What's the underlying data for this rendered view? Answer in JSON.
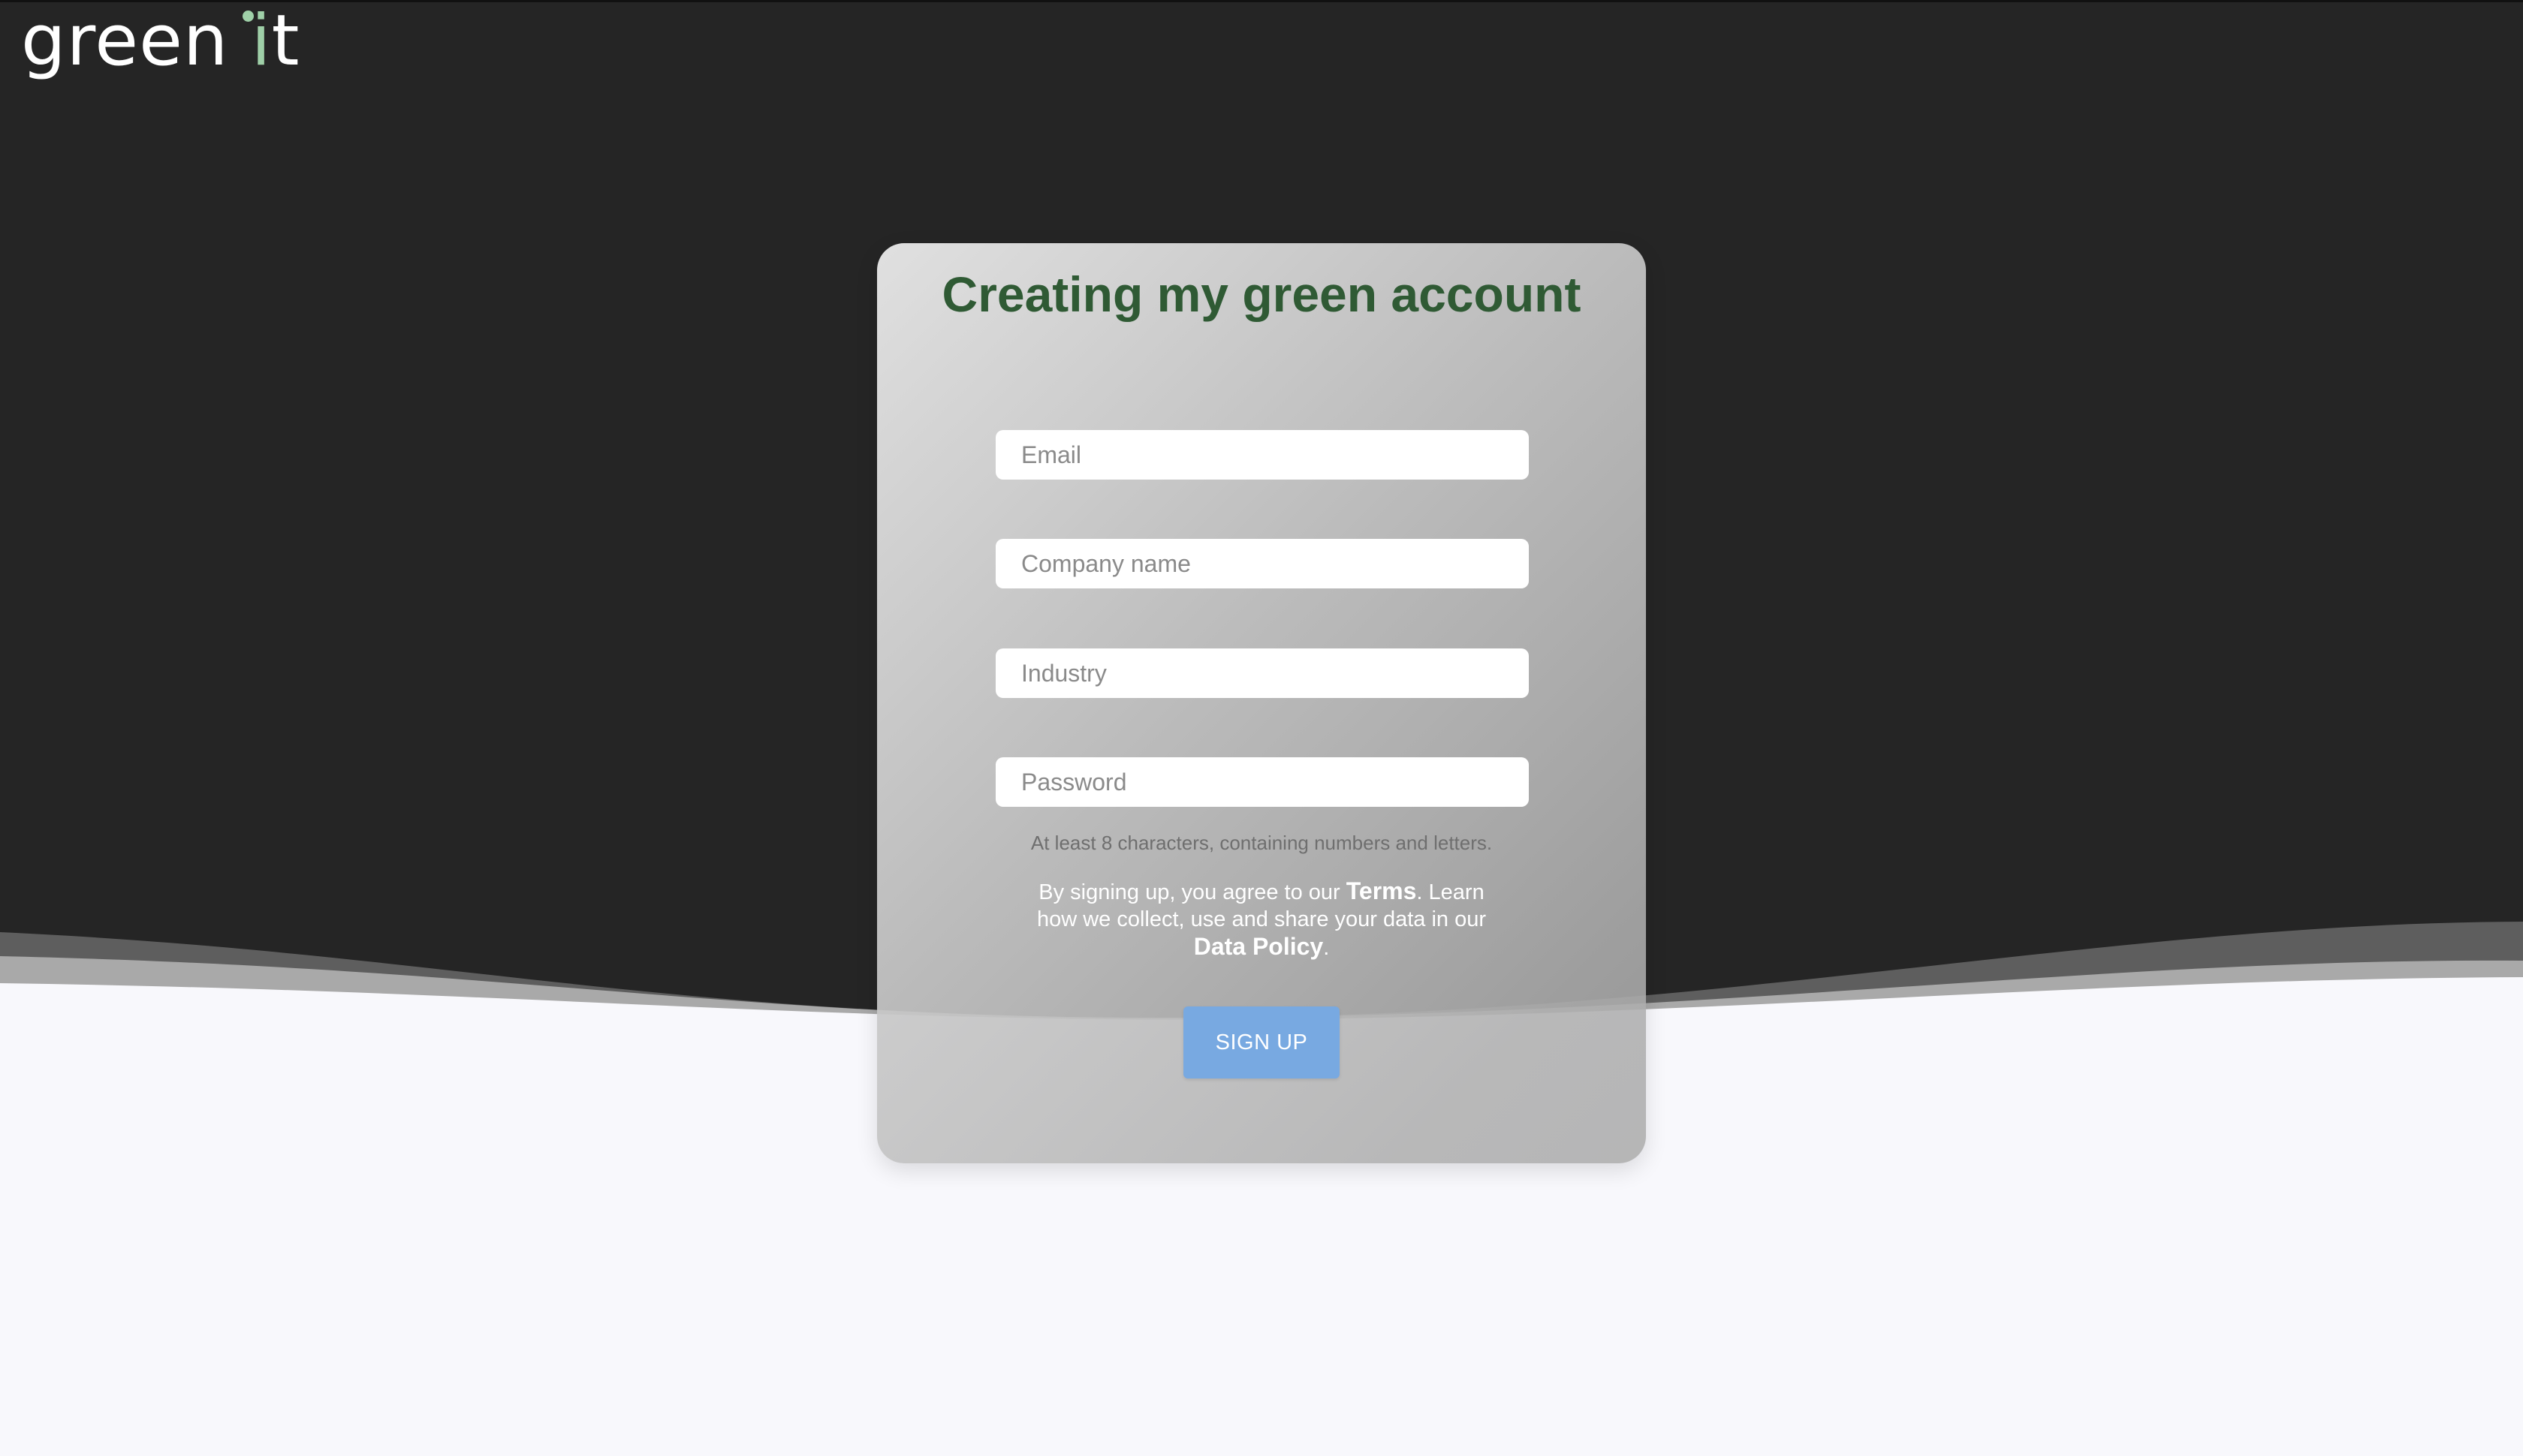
{
  "logo": {
    "word1": "green",
    "word2_i": "i",
    "word2_t": "t"
  },
  "form": {
    "title": "Creating my green account",
    "email_placeholder": "Email",
    "company_placeholder": "Company name",
    "industry_placeholder": "Industry",
    "password_placeholder": "Password",
    "password_hint": "At least 8 characters, containing numbers and letters.",
    "legal": {
      "part1": "By signing up, you agree to our ",
      "terms_link": "Terms",
      "part2": ". Learn how we collect, use and share your data in our ",
      "policy_link": "Data Policy",
      "part3": "."
    },
    "signup_label": "SIGN UP"
  },
  "colors": {
    "title": "#2f5a34",
    "logo_accent": "#9fd0a8",
    "signup_button": "#78a9e1",
    "header_bg": "#252525",
    "page_bg": "#f8f8fc"
  }
}
